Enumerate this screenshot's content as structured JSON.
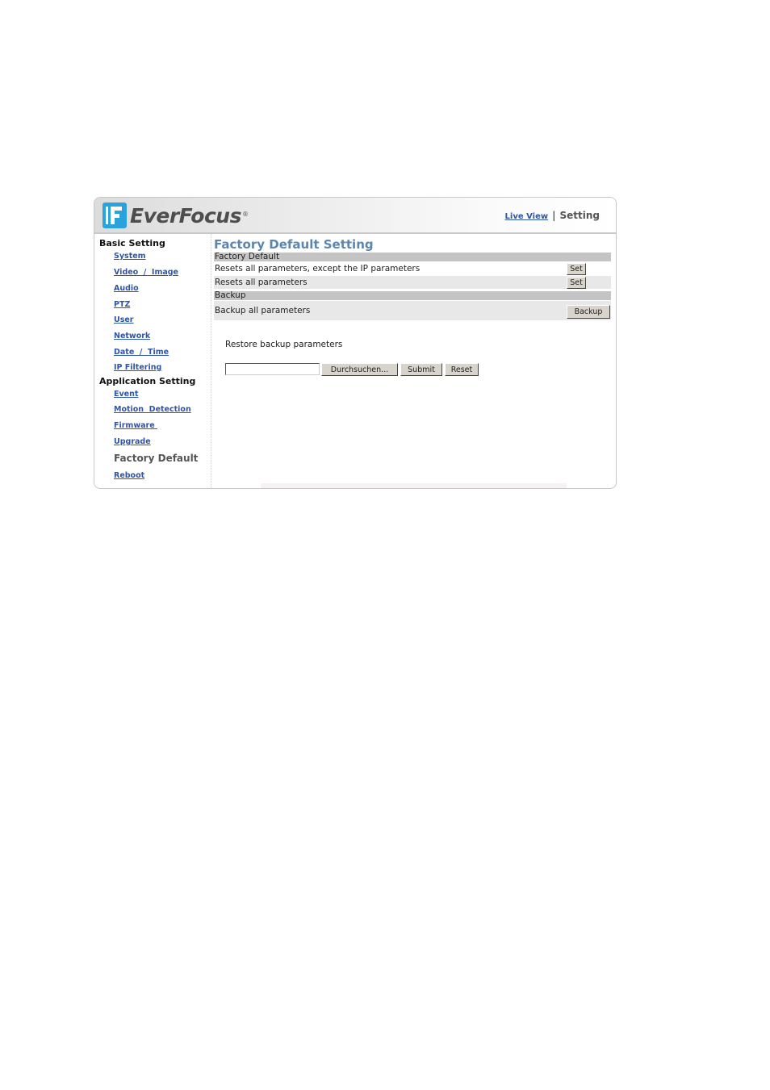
{
  "header": {
    "brand": "EverFocus",
    "brand_mark": "®",
    "nav_live_view": "Live View",
    "nav_separator": "|",
    "nav_current": "Setting"
  },
  "sidebar": {
    "basic_heading": "Basic Setting",
    "basic_items": [
      {
        "label": "System"
      },
      {
        "label": "Video  /  Image"
      },
      {
        "label": "Audio"
      },
      {
        "label": "PTZ"
      },
      {
        "label": "User"
      },
      {
        "label": "Network"
      },
      {
        "label": "Date  /  Time"
      },
      {
        "label": "IP Filtering"
      }
    ],
    "app_heading": "Application Setting",
    "app_items": [
      {
        "label": "Event"
      },
      {
        "label": "Motion  Detection"
      },
      {
        "label": "Firmware "
      },
      {
        "label": "Upgrade"
      }
    ],
    "current_item": "Factory Default",
    "reboot_item": "Reboot"
  },
  "main": {
    "title": "Factory Default Setting",
    "factory_section": "Factory Default",
    "rows": [
      {
        "label": "Resets all parameters, except the IP parameters",
        "button": "Set"
      },
      {
        "label": "Resets all parameters",
        "button": "Set"
      }
    ],
    "backup_section": "Backup",
    "backup_row": {
      "label": "Backup all parameters",
      "button": "Backup"
    },
    "restore": {
      "label": "Restore backup parameters",
      "file_value": "",
      "browse_button": "Durchsuchen...",
      "submit_button": "Submit",
      "reset_button": "Reset"
    }
  }
}
